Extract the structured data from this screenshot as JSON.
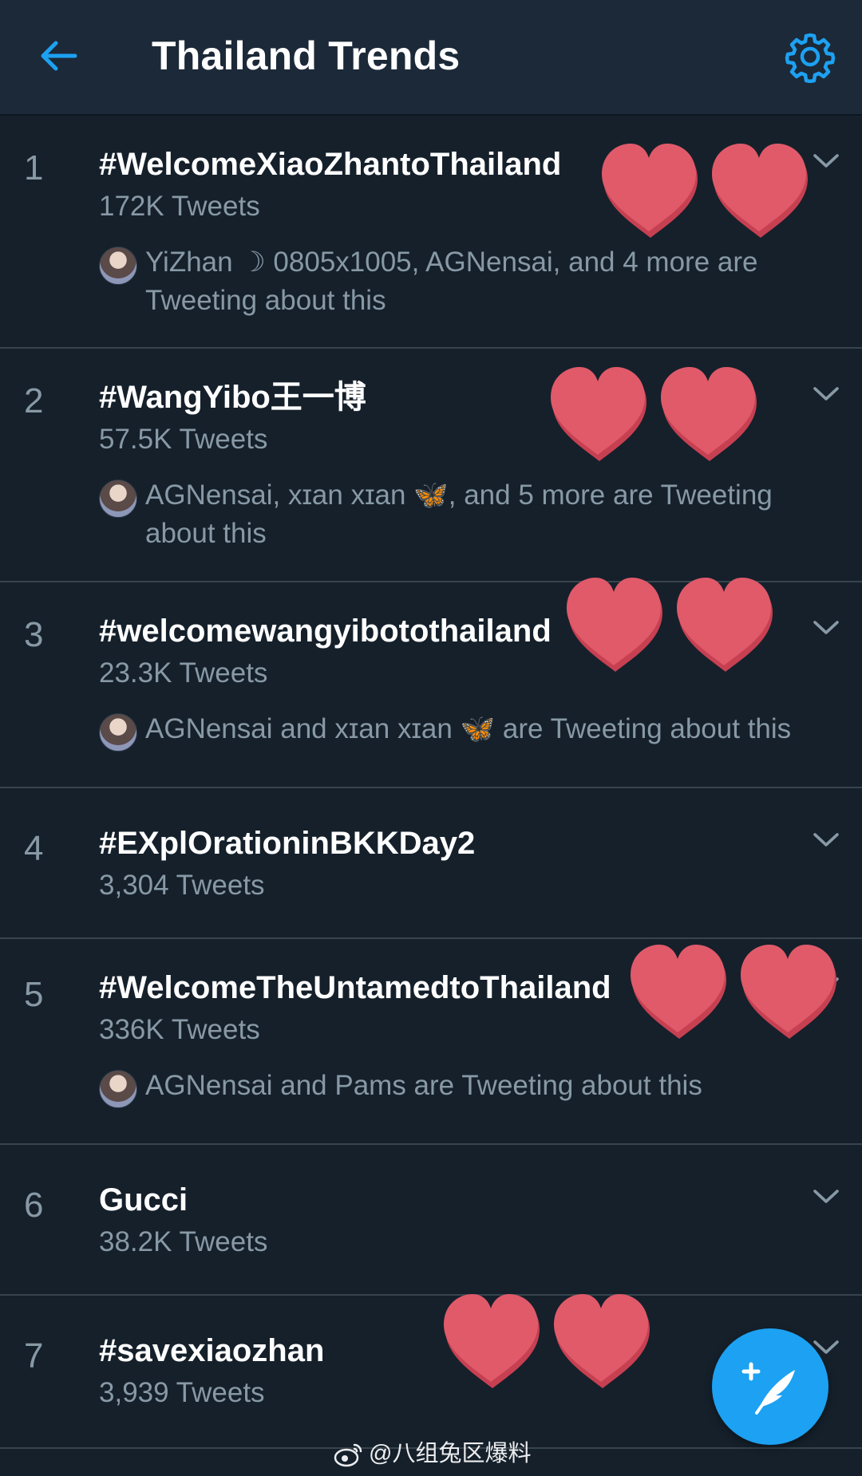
{
  "header": {
    "title": "Thailand Trends",
    "back_icon": "arrow-left-icon",
    "settings_icon": "gear-icon",
    "accent_color": "#1da1f2"
  },
  "trends": [
    {
      "rank": "1",
      "topic": "#WelcomeXiaoZhantoThailand",
      "tweets": "172K Tweets",
      "context": "YiZhan ☽ 0805x1005, AGNensai, and 4 more are Tweeting about this"
    },
    {
      "rank": "2",
      "topic": "#WangYibo王一博",
      "tweets": "57.5K Tweets",
      "context": "AGNensai, xɪan xɪan 🦋, and 5 more are Tweeting about this"
    },
    {
      "rank": "3",
      "topic": "#welcomewangyibotothailand",
      "tweets": "23.3K Tweets",
      "context": "AGNensai and xɪan xɪan 🦋 are Tweeting about this"
    },
    {
      "rank": "4",
      "topic": "#EXplOrationinBKKDay2",
      "tweets": "3,304 Tweets"
    },
    {
      "rank": "5",
      "topic": "#WelcomeTheUntamedtoThailand",
      "tweets": "336K Tweets",
      "context": "AGNensai and Pams are Tweeting about this"
    },
    {
      "rank": "6",
      "topic": "Gucci",
      "tweets": "38.2K Tweets"
    },
    {
      "rank": "7",
      "topic": "#savexiaozhan",
      "tweets": "3,939 Tweets"
    }
  ],
  "overlay": {
    "heart_color": "#e05a6a",
    "heart_icon": "heart-icon"
  },
  "fab": {
    "icon": "compose-tweet-icon"
  },
  "watermark": {
    "text": "@八组兔区爆料",
    "icon": "weibo-icon"
  }
}
